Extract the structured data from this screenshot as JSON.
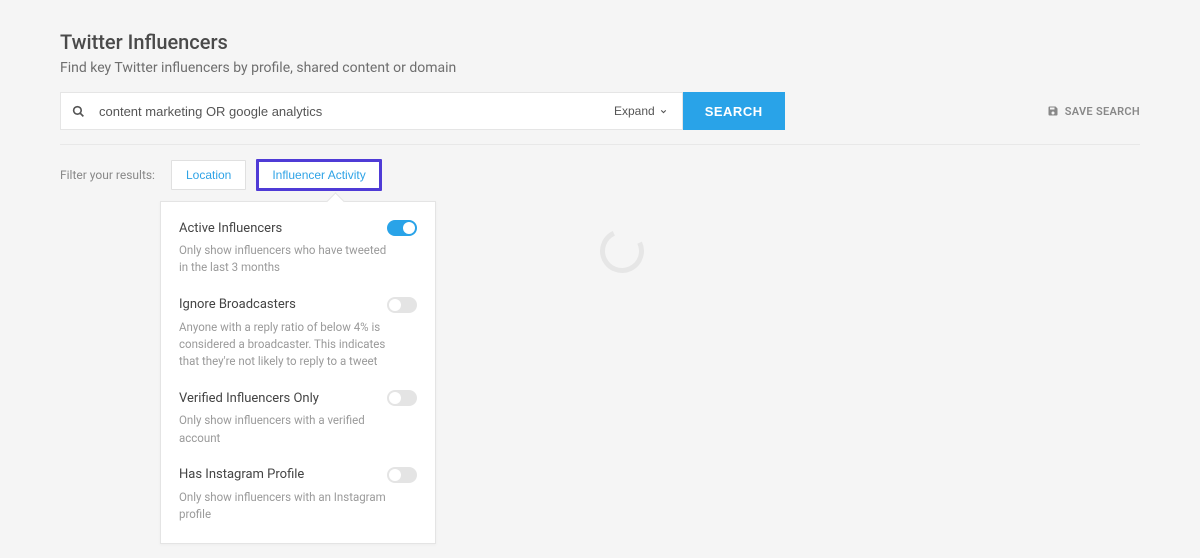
{
  "header": {
    "title": "Twitter Influencers",
    "subtitle": "Find key Twitter influencers by profile, shared content or domain"
  },
  "search": {
    "value": "content marketing OR google analytics",
    "expand_label": "Expand",
    "button_label": "SEARCH"
  },
  "save_search_label": "SAVE SEARCH",
  "filter": {
    "label": "Filter your results:",
    "tabs": {
      "location": "Location",
      "activity": "Influencer Activity"
    }
  },
  "activity_options": {
    "active": {
      "title": "Active Influencers",
      "desc": "Only show influencers who have tweeted in the last 3 months"
    },
    "ignore_broadcasters": {
      "title": "Ignore Broadcasters",
      "desc": "Anyone with a reply ratio of below 4% is considered a broadcaster. This indicates that they're not likely to reply to a tweet"
    },
    "verified": {
      "title": "Verified Influencers Only",
      "desc": "Only show influencers with a verified account"
    },
    "instagram": {
      "title": "Has Instagram Profile",
      "desc": "Only show influencers with an Instagram profile"
    }
  }
}
